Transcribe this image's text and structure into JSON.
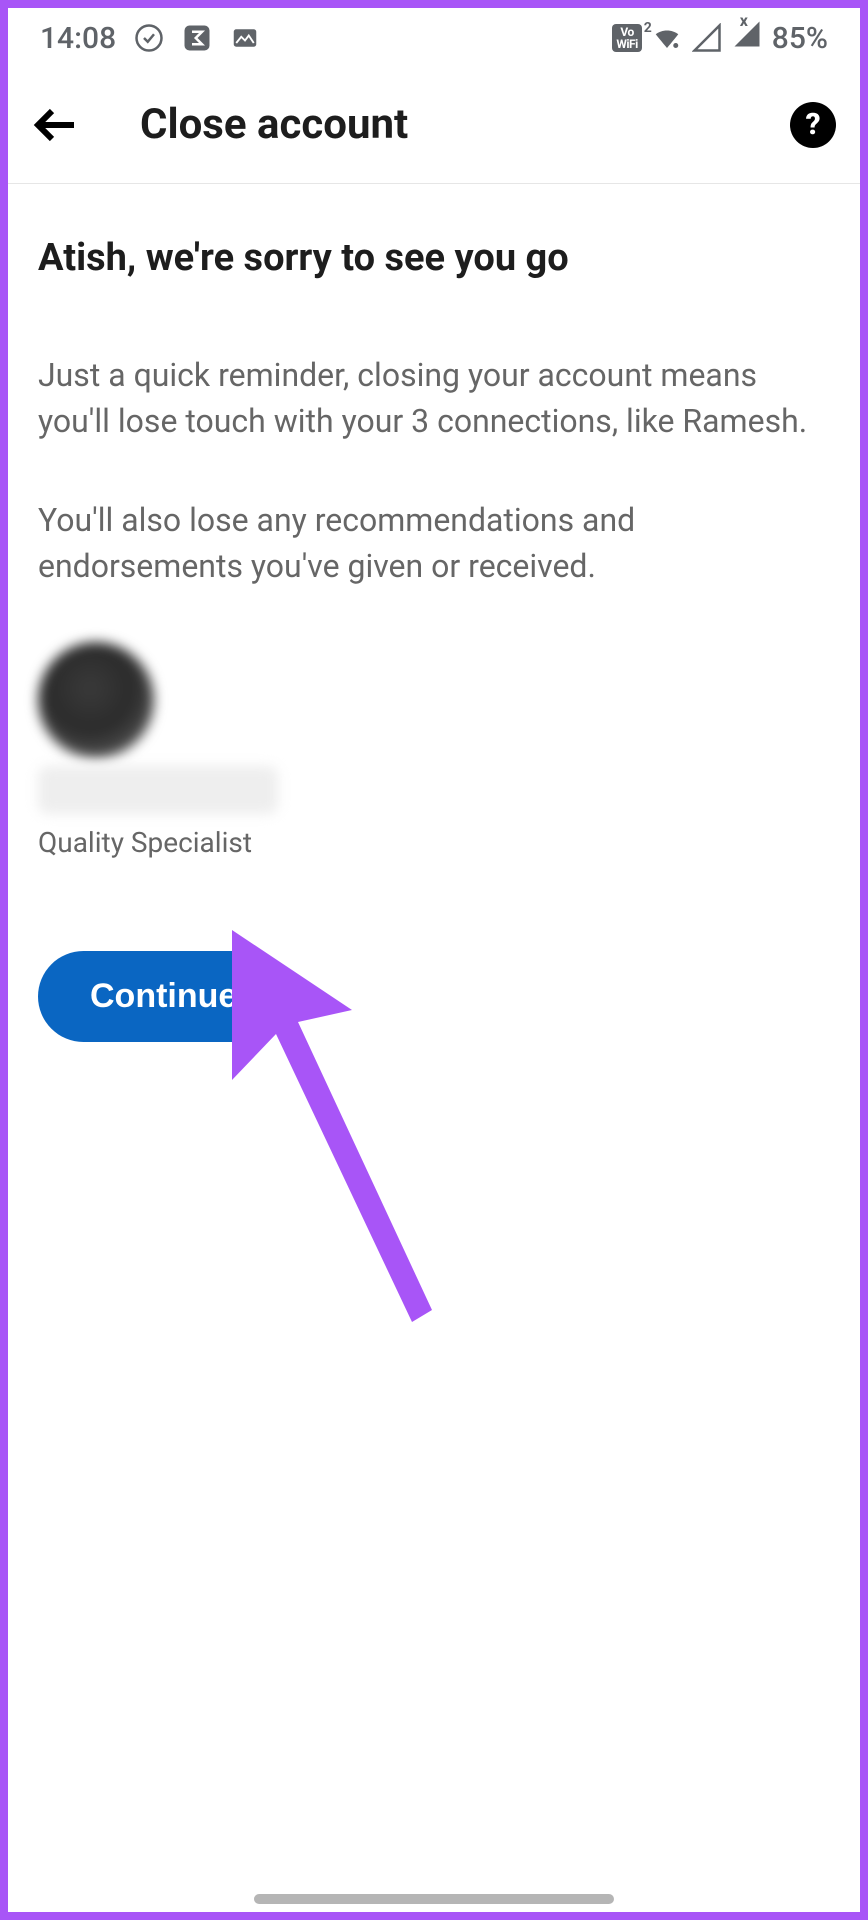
{
  "status_bar": {
    "time": "14:08",
    "battery_percent": "85%"
  },
  "app_bar": {
    "title": "Close account",
    "help_glyph": "?"
  },
  "content": {
    "headline": "Atish, we're sorry to see you go",
    "reminder": "Just a quick reminder, closing your account means you'll lose touch with your 3 connections, like Ramesh.",
    "lose_info": "You'll also lose any recommendations and endorsements you've given or received.",
    "profile": {
      "subtitle": "Quality Specialist"
    },
    "continue_label": "Continue"
  },
  "colors": {
    "accent": "#0a66c2",
    "annotation": "#a855f7"
  }
}
